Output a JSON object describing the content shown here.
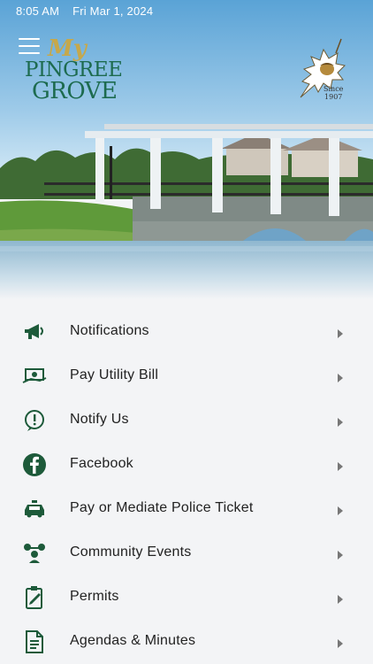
{
  "status_bar": {
    "time": "8:05 AM",
    "date": "Fri Mar 1, 2024"
  },
  "logo": {
    "my": "My",
    "line1": "PINGREE",
    "line2": "GROVE"
  },
  "seal": {
    "since": "Since",
    "year": "1907"
  },
  "colors": {
    "brand_green": "#1d5a3a",
    "logo_gold": "#c6a84b",
    "background": "#f3f4f6"
  },
  "menu": [
    {
      "label": "Notifications",
      "icon": "megaphone-icon"
    },
    {
      "label": "Pay Utility Bill",
      "icon": "money-hand-icon"
    },
    {
      "label": "Notify Us",
      "icon": "exclamation-bubble-icon"
    },
    {
      "label": "Facebook",
      "icon": "facebook-icon"
    },
    {
      "label": "Pay or Mediate Police Ticket",
      "icon": "police-car-icon"
    },
    {
      "label": "Community Events",
      "icon": "community-group-icon"
    },
    {
      "label": "Permits",
      "icon": "clipboard-pen-icon"
    },
    {
      "label": "Agendas & Minutes",
      "icon": "document-icon"
    }
  ]
}
